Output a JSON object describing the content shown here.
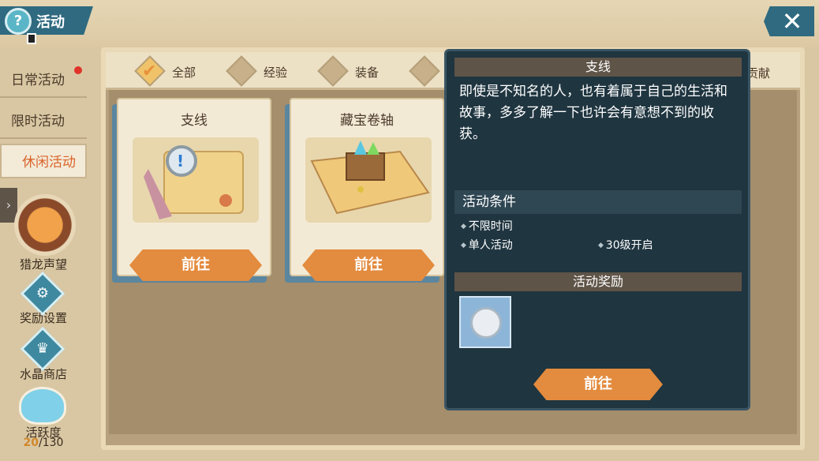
{
  "header": {
    "title": "活动",
    "help_icon": "?",
    "close_icon": "✕"
  },
  "nav": {
    "items": [
      {
        "label": "日常活动",
        "badge": true
      },
      {
        "label": "限时活动",
        "badge": false
      },
      {
        "label": "休闲活动",
        "badge": false,
        "active": true
      }
    ]
  },
  "side": {
    "items": [
      {
        "label": "猎龙声望",
        "icon": "dragon-emblem-icon"
      },
      {
        "label": "奖励设置",
        "icon": "gear-icon",
        "glyph": "⚙"
      },
      {
        "label": "水晶商店",
        "icon": "crystal-shop-icon",
        "glyph": "♛"
      },
      {
        "label": "活跃度",
        "icon": "mascot-icon"
      }
    ],
    "activity": {
      "current": "20",
      "total": "/130"
    }
  },
  "filters": [
    {
      "label": "全部",
      "selected": true
    },
    {
      "label": "经验",
      "selected": false
    },
    {
      "label": "装备",
      "selected": false
    }
  ],
  "filter_tail": "贡献",
  "cards": [
    {
      "title": "支线",
      "button": "前往",
      "art": "side-quest-scroll-icon"
    },
    {
      "title": "藏宝卷轴",
      "button": "前往",
      "art": "treasure-map-icon"
    }
  ],
  "detail": {
    "title": "支线",
    "description": "即使是不知名的人，也有着属于自己的生活和故事，多多了解一下也许会有意想不到的收获。",
    "conditions_header": "活动条件",
    "conditions": [
      "不限时间",
      "单人活动",
      "30级开启"
    ],
    "rewards_header": "活动奖励",
    "reward_icon": "silver-coin-icon",
    "button": "前往"
  },
  "colors": {
    "accent": "#e38b3e",
    "panel_dark": "#1f3540",
    "header_teal": "#2f6a80"
  }
}
